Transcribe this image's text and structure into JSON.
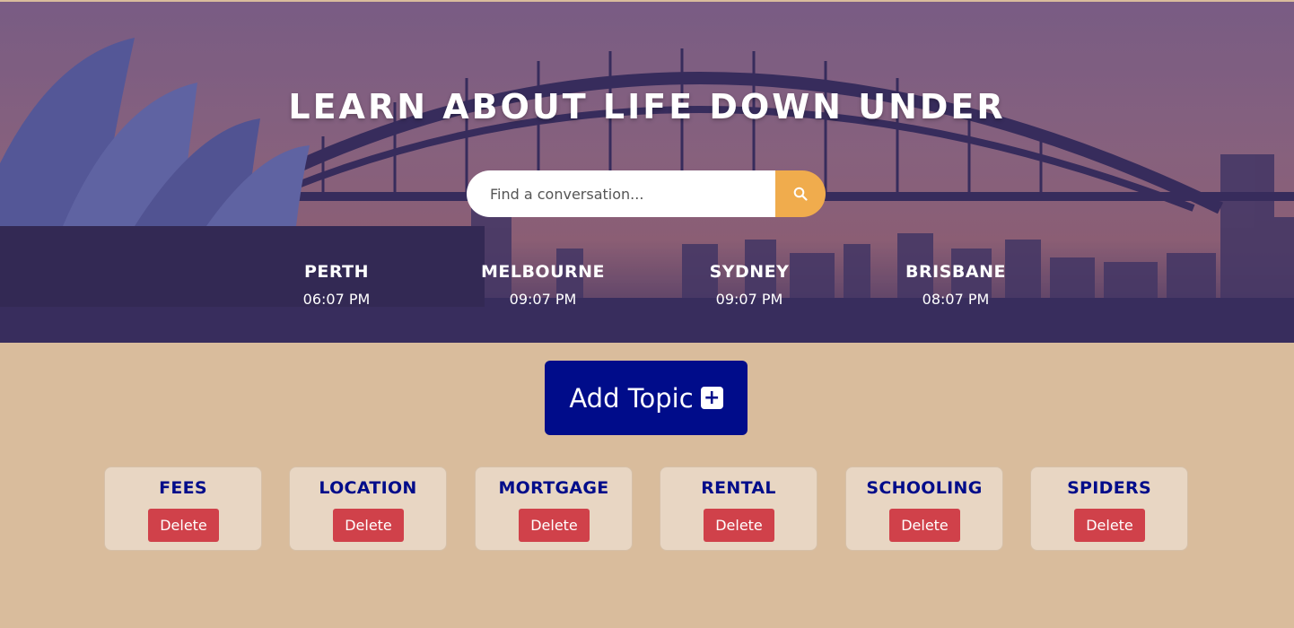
{
  "hero": {
    "title": "LEARN ABOUT LIFE DOWN UNDER",
    "background_icon": "sydney-harbour-image"
  },
  "search": {
    "placeholder": "Find a conversation...",
    "value": "",
    "button_icon": "search-icon",
    "button_color": "#f0ac4d"
  },
  "cities": [
    {
      "name": "PERTH",
      "time": "06:07 PM"
    },
    {
      "name": "MELBOURNE",
      "time": "09:07 PM"
    },
    {
      "name": "SYDNEY",
      "time": "09:07 PM"
    },
    {
      "name": "BRISBANE",
      "time": "08:07 PM"
    }
  ],
  "add_topic": {
    "label": "Add Topic",
    "icon": "plus-square-icon",
    "color": "#000c8a"
  },
  "topics": [
    {
      "name": "FEES",
      "delete_label": "Delete"
    },
    {
      "name": "LOCATION",
      "delete_label": "Delete"
    },
    {
      "name": "MORTGAGE",
      "delete_label": "Delete"
    },
    {
      "name": "RENTAL",
      "delete_label": "Delete"
    },
    {
      "name": "SCHOOLING",
      "delete_label": "Delete"
    },
    {
      "name": "SPIDERS",
      "delete_label": "Delete"
    }
  ],
  "colors": {
    "page_background": "#d9bc9c",
    "card_background": "#e8d6c3",
    "topic_text": "#000c8a",
    "delete_button": "#d0414a"
  }
}
